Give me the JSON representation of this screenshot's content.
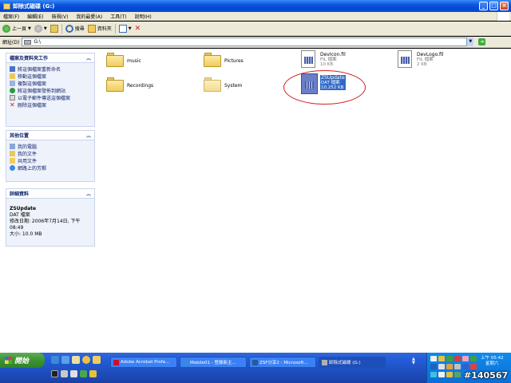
{
  "window": {
    "title": "卸除式磁碟 (G:)",
    "buttons": {
      "minimize": "_",
      "maximize": "□",
      "close": "×"
    }
  },
  "menubar": {
    "items": [
      "檔案(F)",
      "編輯(E)",
      "檢視(V)",
      "我的最愛(A)",
      "工具(T)",
      "說明(H)"
    ]
  },
  "toolbar": {
    "back_label": "上一頁",
    "search_label": "搜尋",
    "folders_label": "資料夾"
  },
  "address": {
    "label": "網址(D)",
    "value": "G:\\"
  },
  "tasks_panel": {
    "title": "檔案及資料夾工作",
    "items": [
      {
        "label": "將這個檔案重新命名",
        "icon": "rename-icon"
      },
      {
        "label": "移動這個檔案",
        "icon": "move-icon"
      },
      {
        "label": "複製這個檔案",
        "icon": "copy-icon"
      },
      {
        "label": "將這個檔案發佈到網站",
        "icon": "web-publish-icon"
      },
      {
        "label": "以電子郵件傳送這個檔案",
        "icon": "email-icon"
      },
      {
        "label": "刪除這個檔案",
        "icon": "delete-icon"
      }
    ]
  },
  "places_panel": {
    "title": "其他位置",
    "items": [
      {
        "label": "我的電腦",
        "icon": "my-computer-icon"
      },
      {
        "label": "我的文件",
        "icon": "my-documents-icon"
      },
      {
        "label": "共用文件",
        "icon": "shared-documents-icon"
      },
      {
        "label": "網路上的芳鄰",
        "icon": "network-places-icon"
      }
    ]
  },
  "details_panel": {
    "title": "詳細資料",
    "name": "ZSUpdate",
    "type": "DAT 檔案",
    "modified_1": "修改日期: 2006年7月14日, 下午",
    "modified_2": "08:49",
    "size": "大小: 10.0 MB"
  },
  "files": {
    "music": {
      "name": "music"
    },
    "pictures": {
      "name": "Pictures"
    },
    "recordings": {
      "name": "Recordings"
    },
    "system": {
      "name": "System"
    },
    "devicon": {
      "name": "DevIcon.fil",
      "type": "FIL 檔案",
      "size": "10 KB"
    },
    "devlogo": {
      "name": "DevLogo.fil",
      "type": "FIL 檔案",
      "size": "2 KB"
    },
    "zsupdate": {
      "name": "ZSUpdate",
      "type": "DAT 檔案",
      "size": "10,252 KB"
    }
  },
  "taskbar": {
    "start_label": "開始",
    "tasks": [
      {
        "label": "Adobe Acrobat Profe..."
      },
      {
        "label": "Mobile01 - 登錄新主..."
      },
      {
        "label": "ZSF分享2 - Microsoft..."
      },
      {
        "label": "卸除式磁碟 (G:)"
      }
    ],
    "clock_time": "上午 05:42",
    "clock_day": "星期六"
  },
  "watermark": "#140567",
  "colors": {
    "title_blue": "#0a55e0",
    "task_pane_bg": "#eef2fb",
    "selection": "#316ac5",
    "annotation_circle": "#d02020",
    "start_green": "#3c9332"
  }
}
